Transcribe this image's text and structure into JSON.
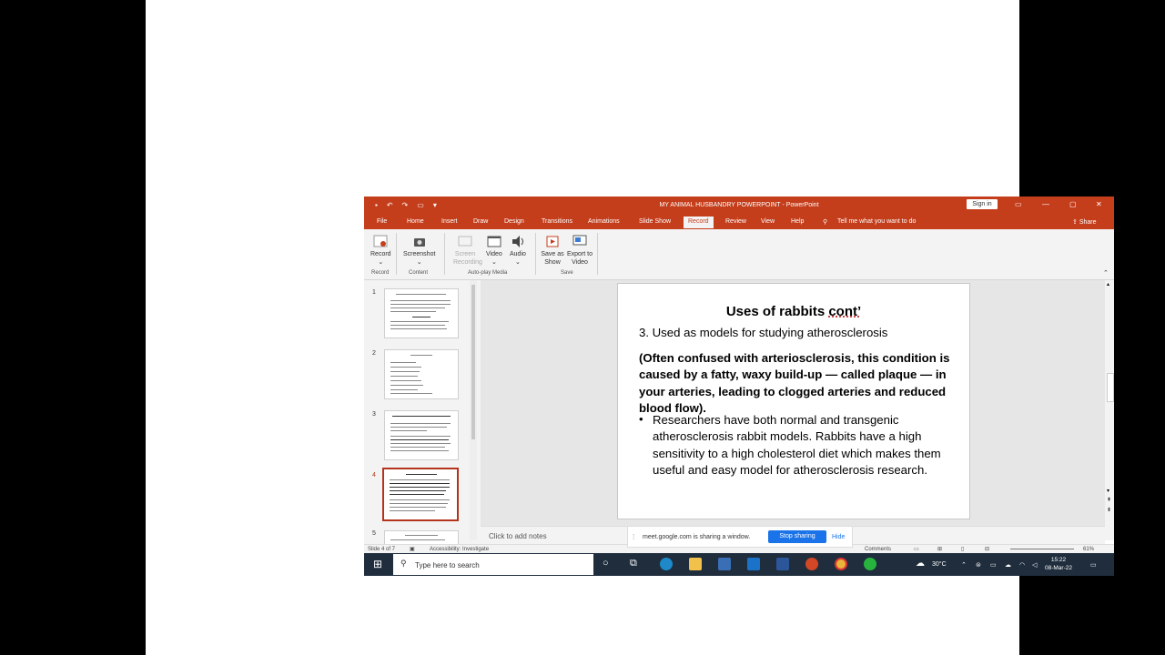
{
  "window": {
    "title": "MY ANIMAL HUSBANDRY POWERPOINT  -  PowerPoint",
    "signin_label": "Sign in",
    "controls": [
      "▭",
      "—",
      "▢",
      "✕"
    ]
  },
  "menu": {
    "tabs": [
      "File",
      "Home",
      "Insert",
      "Draw",
      "Design",
      "Transitions",
      "Animations",
      "Slide Show",
      "Record",
      "Review",
      "View",
      "Help"
    ],
    "active_tab": "Record",
    "tell_me": "Tell me what you want to do",
    "share": "Share"
  },
  "ribbon": {
    "record_label": "Record",
    "screenshot_label": "Screenshot",
    "screen_recording_label": "Screen Recording",
    "video_label": "Video",
    "audio_label": "Audio",
    "save_as_show_label": "Save as Show",
    "export_video_label": "Export to Video",
    "groups": {
      "record": "Record",
      "content": "Content",
      "autoplay": "Auto-play Media",
      "save": "Save"
    }
  },
  "thumbnails": [
    {
      "num": "1"
    },
    {
      "num": "2"
    },
    {
      "num": "3"
    },
    {
      "num": "4"
    },
    {
      "num": "5"
    }
  ],
  "slide": {
    "title": "Uses of rabbits ",
    "title_underlined": "cont’",
    "point": "3. Used as models for studying atherosclerosis",
    "bold_text": "(Often confused with arteriosclerosis, this condition is caused by a fatty, waxy build-up — called plaque — in your arteries, leading to clogged arteries and reduced blood flow).",
    "bullet_symbol": "•",
    "bullet_text": "Researchers have both normal and transgenic atherosclerosis rabbit models. Rabbits have a high sensitivity to a high cholesterol diet which makes them useful and easy model for atherosclerosis research."
  },
  "notes": {
    "placeholder": "Click to add notes"
  },
  "status": {
    "slide_info": "Slide 4 of 7",
    "accessibility": "Accessibility: Investigate",
    "comments": "Comments",
    "zoom": "61%"
  },
  "sharebar": {
    "message": "meet.google.com is sharing a window.",
    "stop_label": "Stop sharing",
    "hide_label": "Hide"
  },
  "taskbar": {
    "search_placeholder": "Type here to search",
    "weather": "30°C",
    "time": "15:22",
    "date": "08-Mar-22"
  }
}
